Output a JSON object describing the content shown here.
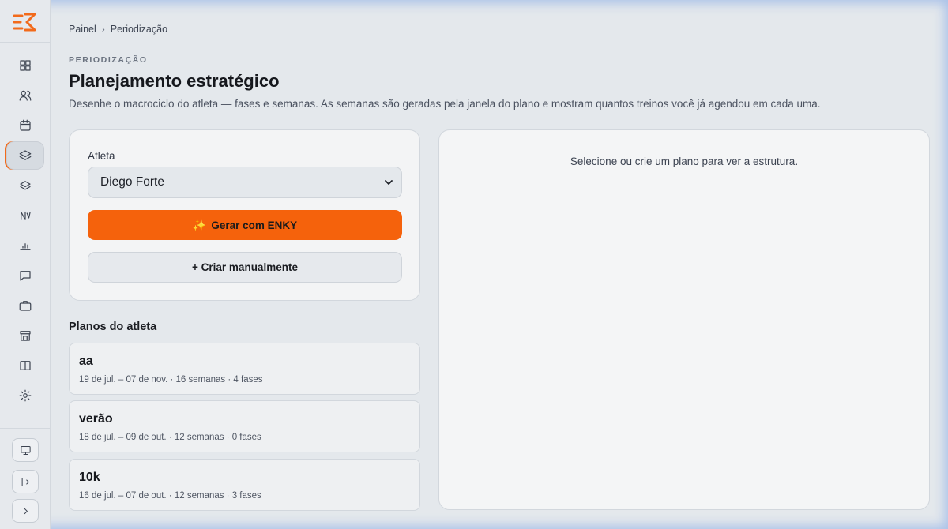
{
  "colors": {
    "accent": "#f5620c",
    "background": "#e4e8ec",
    "card": "#f3f4f5"
  },
  "sidebar": {
    "items": [
      {
        "icon": "dashboard-grid-icon"
      },
      {
        "icon": "users-icon"
      },
      {
        "icon": "calendar-icon"
      },
      {
        "icon": "layers-icon",
        "active": true
      },
      {
        "icon": "layers-outline-icon"
      },
      {
        "icon": "activity-wave-icon"
      },
      {
        "icon": "bar-chart-icon"
      },
      {
        "icon": "chat-bubble-icon"
      },
      {
        "icon": "briefcase-icon"
      },
      {
        "icon": "store-icon"
      },
      {
        "icon": "book-open-icon"
      },
      {
        "icon": "gear-icon"
      }
    ],
    "bottom": [
      {
        "icon": "monitor-icon"
      },
      {
        "icon": "logout-icon"
      },
      {
        "icon": "chevron-right-icon"
      }
    ]
  },
  "breadcrumb": {
    "root": "Painel",
    "separator": "›",
    "current": "Periodização"
  },
  "header": {
    "eyebrow": "PERIODIZAÇÃO",
    "title": "Planejamento estratégico",
    "description": "Desenhe o macrociclo do atleta — fases e semanas. As semanas são geradas pela janela do plano e mostram quantos treinos você já agendou em cada uma."
  },
  "form": {
    "athlete_label": "Atleta",
    "athlete_selected": "Diego Forte",
    "generate_icon": "✨",
    "generate_label": "Gerar com ENKY",
    "manual_label": "+ Criar manualmente"
  },
  "plans": {
    "title": "Planos do atleta",
    "items": [
      {
        "name": "aa",
        "meta": "19 de jul. – 07 de nov. · 16 semanas · 4 fases"
      },
      {
        "name": "verão",
        "meta": "18 de jul. – 09 de out. · 12 semanas · 0 fases"
      },
      {
        "name": "10k",
        "meta": "16 de jul. – 07 de out. · 12 semanas · 3 fases"
      }
    ]
  },
  "structure": {
    "empty_message": "Selecione ou crie um plano para ver a estrutura."
  }
}
